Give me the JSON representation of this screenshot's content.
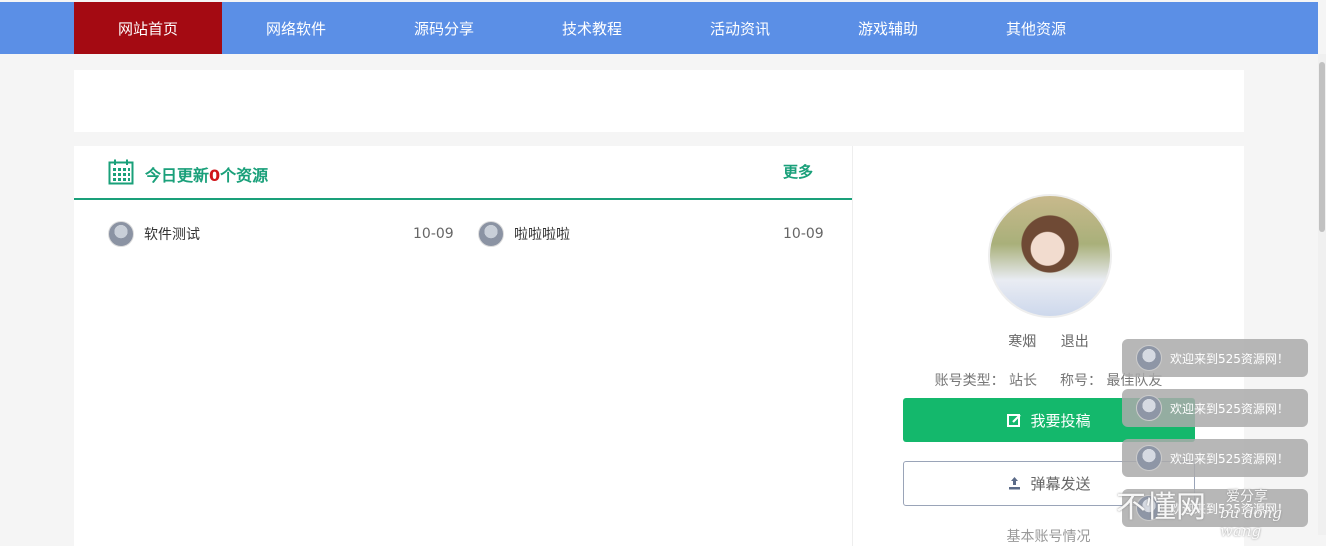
{
  "nav": {
    "items": [
      "网站首页",
      "网络软件",
      "源码分享",
      "技术教程",
      "活动资讯",
      "游戏辅助",
      "其他资源"
    ]
  },
  "today": {
    "prefix": "今日更新",
    "count": "0",
    "suffix": "个资源",
    "more": "更多",
    "rows": [
      {
        "title": "软件测试",
        "date": "10-09"
      },
      {
        "title": "啦啦啦啦",
        "date": "10-09"
      }
    ]
  },
  "user": {
    "name": "寒烟",
    "logout": "退出",
    "account_type_label": "账号类型：",
    "account_type": "站长",
    "title_label": "称号：",
    "title": "最佳队友",
    "submit_button": "我要投稿",
    "danmu_button": "弹幕发送",
    "cut_text": "基本账号情况"
  },
  "toasts": [
    "欢迎来到525资源网！",
    "欢迎来到525资源网！",
    "欢迎来到525资源网！",
    "欢迎来到525资源网！"
  ],
  "watermark": {
    "main": "不懂网",
    "sub": "爱分享",
    "pinyin": "bu dong wang"
  },
  "colors": {
    "nav_bg": "#5b8fe6",
    "nav_active": "#a40a12",
    "accent_green": "#1aa07a",
    "button_green": "#14b86c",
    "count_red": "#d0141a"
  }
}
